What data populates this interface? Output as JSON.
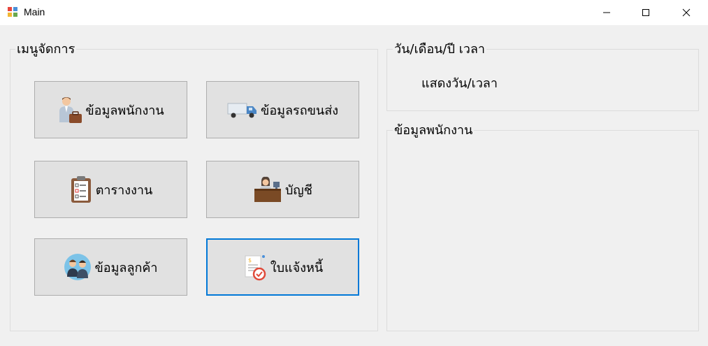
{
  "window": {
    "title": "Main"
  },
  "menu_group": {
    "title": "เมนูจัดการ",
    "buttons": [
      {
        "label": "ข้อมูลพนักงาน",
        "icon": "employee-icon"
      },
      {
        "label": "ข้อมูลรถขนส่ง",
        "icon": "truck-icon"
      },
      {
        "label": "ตารางงาน",
        "icon": "clipboard-icon"
      },
      {
        "label": "บัญชี",
        "icon": "accountant-icon"
      },
      {
        "label": "ข้อมูลลูกค้า",
        "icon": "customers-icon"
      },
      {
        "label": "ใบแจ้งหนี้",
        "icon": "invoice-icon"
      }
    ]
  },
  "datetime_group": {
    "title": "วัน/เดือน/ปี เวลา",
    "value": "แสดงวัน/เวลา"
  },
  "employee_group": {
    "title": "ข้อมูลพนักงาน"
  },
  "colors": {
    "focus_border": "#0078d7",
    "button_bg": "#e1e1e1",
    "window_bg": "#f0f0f0"
  }
}
